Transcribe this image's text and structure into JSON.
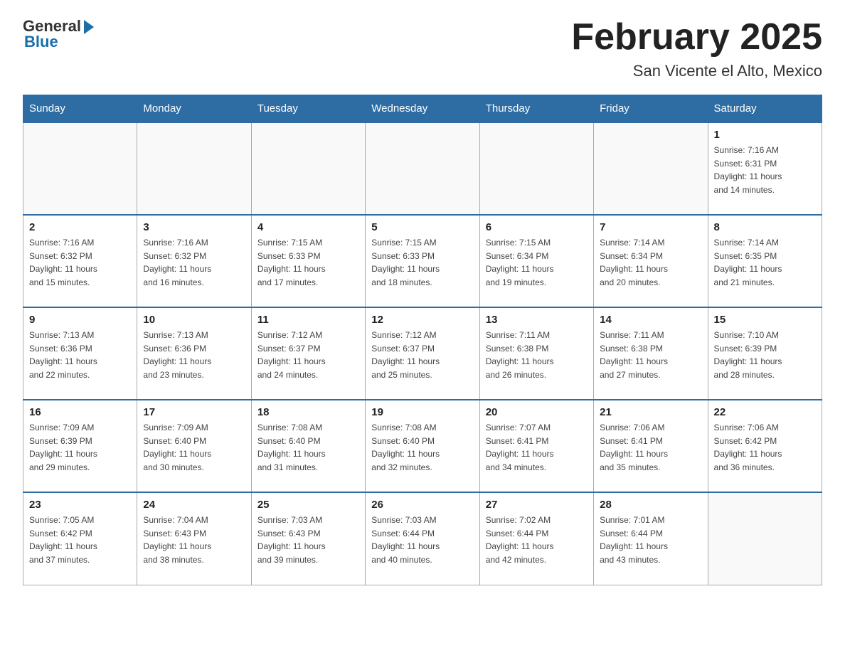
{
  "header": {
    "logo_general": "General",
    "logo_blue": "Blue",
    "month_title": "February 2025",
    "location": "San Vicente el Alto, Mexico"
  },
  "days_of_week": [
    "Sunday",
    "Monday",
    "Tuesday",
    "Wednesday",
    "Thursday",
    "Friday",
    "Saturday"
  ],
  "weeks": [
    [
      {
        "day": "",
        "info": ""
      },
      {
        "day": "",
        "info": ""
      },
      {
        "day": "",
        "info": ""
      },
      {
        "day": "",
        "info": ""
      },
      {
        "day": "",
        "info": ""
      },
      {
        "day": "",
        "info": ""
      },
      {
        "day": "1",
        "info": "Sunrise: 7:16 AM\nSunset: 6:31 PM\nDaylight: 11 hours\nand 14 minutes."
      }
    ],
    [
      {
        "day": "2",
        "info": "Sunrise: 7:16 AM\nSunset: 6:32 PM\nDaylight: 11 hours\nand 15 minutes."
      },
      {
        "day": "3",
        "info": "Sunrise: 7:16 AM\nSunset: 6:32 PM\nDaylight: 11 hours\nand 16 minutes."
      },
      {
        "day": "4",
        "info": "Sunrise: 7:15 AM\nSunset: 6:33 PM\nDaylight: 11 hours\nand 17 minutes."
      },
      {
        "day": "5",
        "info": "Sunrise: 7:15 AM\nSunset: 6:33 PM\nDaylight: 11 hours\nand 18 minutes."
      },
      {
        "day": "6",
        "info": "Sunrise: 7:15 AM\nSunset: 6:34 PM\nDaylight: 11 hours\nand 19 minutes."
      },
      {
        "day": "7",
        "info": "Sunrise: 7:14 AM\nSunset: 6:34 PM\nDaylight: 11 hours\nand 20 minutes."
      },
      {
        "day": "8",
        "info": "Sunrise: 7:14 AM\nSunset: 6:35 PM\nDaylight: 11 hours\nand 21 minutes."
      }
    ],
    [
      {
        "day": "9",
        "info": "Sunrise: 7:13 AM\nSunset: 6:36 PM\nDaylight: 11 hours\nand 22 minutes."
      },
      {
        "day": "10",
        "info": "Sunrise: 7:13 AM\nSunset: 6:36 PM\nDaylight: 11 hours\nand 23 minutes."
      },
      {
        "day": "11",
        "info": "Sunrise: 7:12 AM\nSunset: 6:37 PM\nDaylight: 11 hours\nand 24 minutes."
      },
      {
        "day": "12",
        "info": "Sunrise: 7:12 AM\nSunset: 6:37 PM\nDaylight: 11 hours\nand 25 minutes."
      },
      {
        "day": "13",
        "info": "Sunrise: 7:11 AM\nSunset: 6:38 PM\nDaylight: 11 hours\nand 26 minutes."
      },
      {
        "day": "14",
        "info": "Sunrise: 7:11 AM\nSunset: 6:38 PM\nDaylight: 11 hours\nand 27 minutes."
      },
      {
        "day": "15",
        "info": "Sunrise: 7:10 AM\nSunset: 6:39 PM\nDaylight: 11 hours\nand 28 minutes."
      }
    ],
    [
      {
        "day": "16",
        "info": "Sunrise: 7:09 AM\nSunset: 6:39 PM\nDaylight: 11 hours\nand 29 minutes."
      },
      {
        "day": "17",
        "info": "Sunrise: 7:09 AM\nSunset: 6:40 PM\nDaylight: 11 hours\nand 30 minutes."
      },
      {
        "day": "18",
        "info": "Sunrise: 7:08 AM\nSunset: 6:40 PM\nDaylight: 11 hours\nand 31 minutes."
      },
      {
        "day": "19",
        "info": "Sunrise: 7:08 AM\nSunset: 6:40 PM\nDaylight: 11 hours\nand 32 minutes."
      },
      {
        "day": "20",
        "info": "Sunrise: 7:07 AM\nSunset: 6:41 PM\nDaylight: 11 hours\nand 34 minutes."
      },
      {
        "day": "21",
        "info": "Sunrise: 7:06 AM\nSunset: 6:41 PM\nDaylight: 11 hours\nand 35 minutes."
      },
      {
        "day": "22",
        "info": "Sunrise: 7:06 AM\nSunset: 6:42 PM\nDaylight: 11 hours\nand 36 minutes."
      }
    ],
    [
      {
        "day": "23",
        "info": "Sunrise: 7:05 AM\nSunset: 6:42 PM\nDaylight: 11 hours\nand 37 minutes."
      },
      {
        "day": "24",
        "info": "Sunrise: 7:04 AM\nSunset: 6:43 PM\nDaylight: 11 hours\nand 38 minutes."
      },
      {
        "day": "25",
        "info": "Sunrise: 7:03 AM\nSunset: 6:43 PM\nDaylight: 11 hours\nand 39 minutes."
      },
      {
        "day": "26",
        "info": "Sunrise: 7:03 AM\nSunset: 6:44 PM\nDaylight: 11 hours\nand 40 minutes."
      },
      {
        "day": "27",
        "info": "Sunrise: 7:02 AM\nSunset: 6:44 PM\nDaylight: 11 hours\nand 42 minutes."
      },
      {
        "day": "28",
        "info": "Sunrise: 7:01 AM\nSunset: 6:44 PM\nDaylight: 11 hours\nand 43 minutes."
      },
      {
        "day": "",
        "info": ""
      }
    ]
  ]
}
